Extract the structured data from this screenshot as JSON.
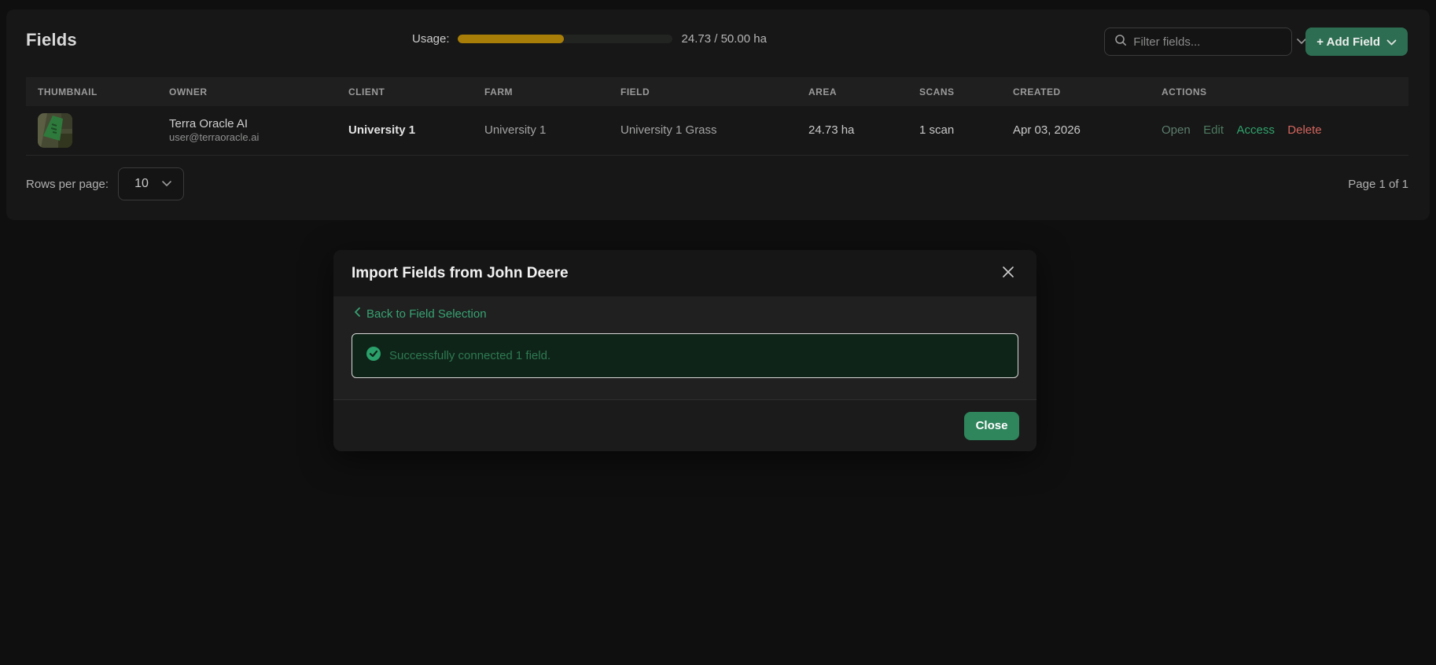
{
  "page": {
    "title": "Fields"
  },
  "usage": {
    "label": "Usage:",
    "value_text": "24.73 / 50.00 ha",
    "percent": 49.5,
    "bar_fill_width": "49.5%"
  },
  "toolbar": {
    "filter_placeholder": "Filter fields...",
    "add_field_label": "+ Add Field"
  },
  "table": {
    "headers": [
      "THUMBNAIL",
      "OWNER",
      "CLIENT",
      "FARM",
      "FIELD",
      "AREA",
      "SCANS",
      "CREATED",
      "ACTIONS"
    ],
    "rows": [
      {
        "owner_name": "Terra Oracle AI",
        "owner_email": "user@terraoracle.ai",
        "client": "University 1",
        "farm": "University 1",
        "field": "University 1 Grass",
        "area": "24.73 ha",
        "scans": "1 scan",
        "created": "Apr 03, 2026",
        "actions": [
          "Open",
          "Edit",
          "Access",
          "Delete"
        ]
      }
    ]
  },
  "pagination": {
    "rows_per_page_label": "Rows per page:",
    "rows_per_page_value": "10",
    "page_info": "Page 1 of 1"
  },
  "modal": {
    "title": "Import Fields from John Deere",
    "back_label": "Back to Field Selection",
    "success_message": "Successfully connected 1 field.",
    "close_button_label": "Close"
  },
  "colors": {
    "accent_green_button": "#2d6e52",
    "close_green_button": "#2f855c",
    "usage_amber": "#a87d08",
    "success_bg": "#0f2418",
    "success_text": "#2d7a52",
    "success_icon": "#2aa06a",
    "action_access": "#31a26d",
    "action_delete": "#d5655f",
    "back_link_green": "#38a273"
  }
}
